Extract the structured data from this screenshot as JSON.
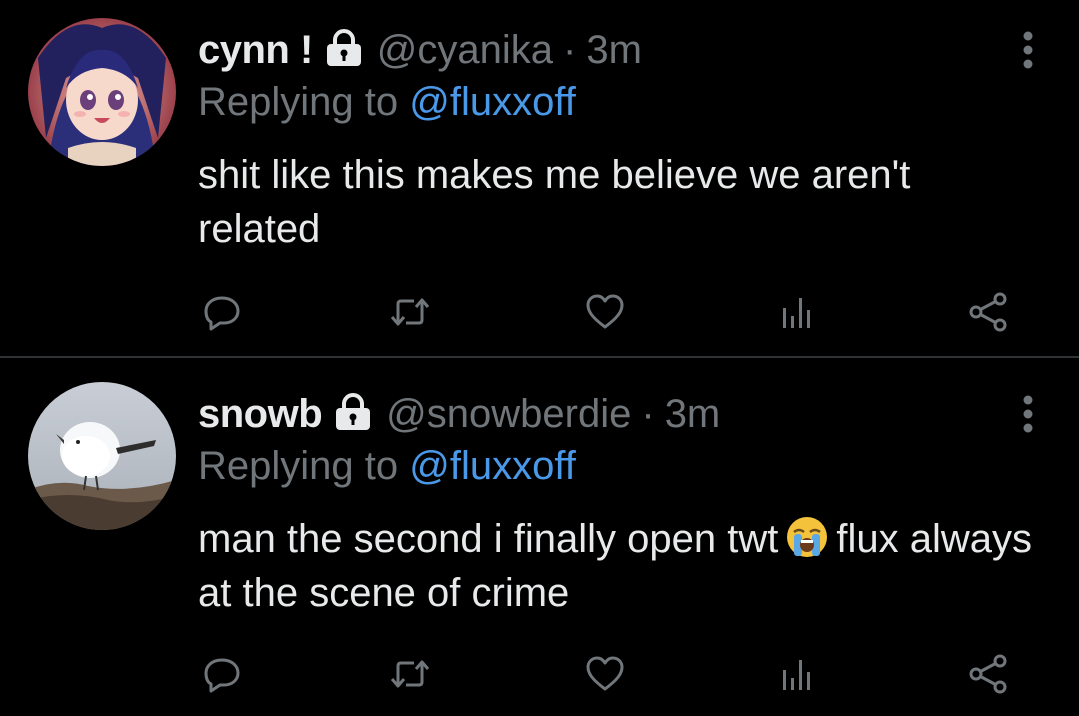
{
  "tweets": [
    {
      "display_name": "cynn !",
      "handle": "@cyanika",
      "separator": "·",
      "time": "3m",
      "replying_prefix": "Replying to",
      "replying_to": "@fluxxoff",
      "text": "shit like this makes me believe we aren't related",
      "avatar_icon": "anime-girl-avatar"
    },
    {
      "display_name": "snowb",
      "handle": "@snowberdie",
      "separator": "·",
      "time": "3m",
      "replying_prefix": "Replying to",
      "replying_to": "@fluxxoff",
      "text_before_emoji": "man the second i finally open twt",
      "text_after_emoji": "flux always at the scene of crime",
      "emoji": "loudly-crying-face",
      "avatar_icon": "white-bird-avatar"
    }
  ],
  "icons": {
    "protected": "lock-icon",
    "more": "more-vertical-icon",
    "reply": "reply-icon",
    "retweet": "retweet-icon",
    "like": "heart-icon",
    "views": "analytics-icon",
    "share": "share-icon"
  },
  "colors": {
    "background": "#000000",
    "text": "#e7e9ea",
    "secondary": "#71767b",
    "link": "#4a99e9",
    "divider": "#2f3336"
  }
}
